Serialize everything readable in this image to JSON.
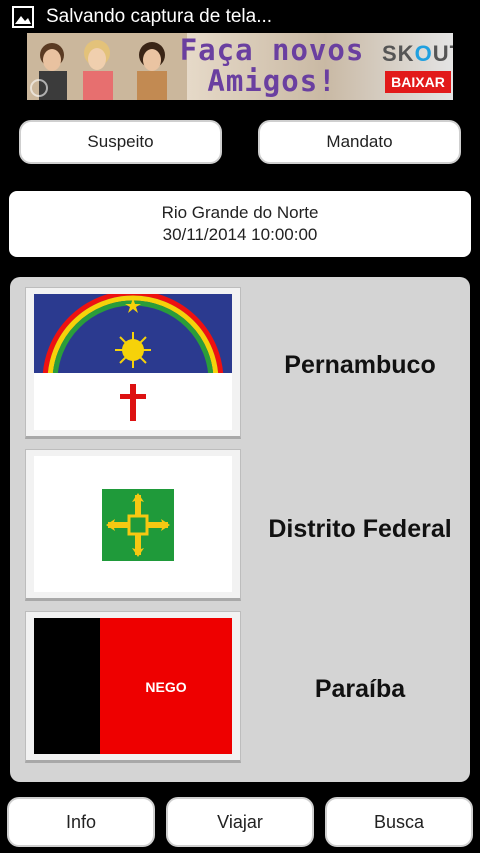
{
  "status_bar": {
    "notification_text": "Salvando captura de tela...",
    "icon": "image-icon"
  },
  "ad": {
    "headline": "Faça novos Amigos!",
    "brand": "SKOUT",
    "cta": "BAIXAR"
  },
  "top_buttons": {
    "suspeito": "Suspeito",
    "mandato": "Mandato"
  },
  "location": {
    "region": "Rio Grande do Norte",
    "datetime": "30/11/2014 10:00:00"
  },
  "states": [
    {
      "name": "Pernambuco",
      "flag": "pernambuco-flag"
    },
    {
      "name": "Distrito Federal",
      "flag": "distrito-federal-flag"
    },
    {
      "name": "Paraíba",
      "flag": "paraiba-flag",
      "flag_text": "NEGO"
    }
  ],
  "bottom_buttons": {
    "info": "Info",
    "viajar": "Viajar",
    "busca": "Busca"
  }
}
